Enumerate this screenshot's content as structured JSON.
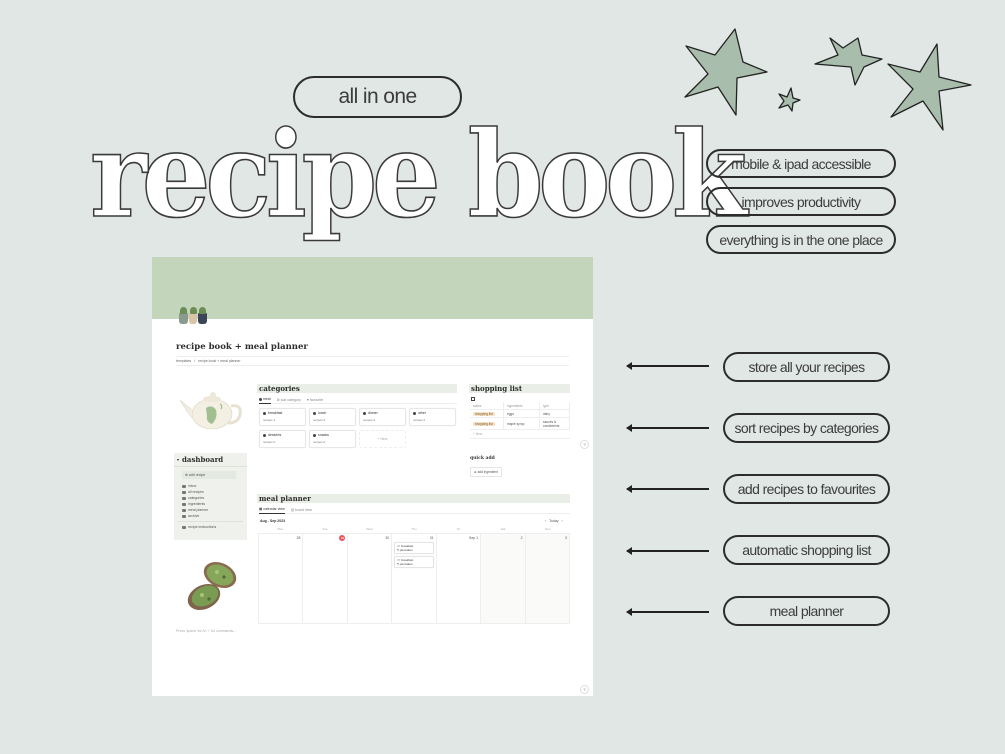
{
  "poster": {
    "tagline": "all in one",
    "title": "recipe book",
    "features": [
      "mobile & ipad accessible",
      "improves productivity",
      "everything is in the one place"
    ],
    "callouts": [
      "store all your recipes",
      "sort recipes by categories",
      "add recipes to favourites",
      "automatic shopping list",
      "meal planner"
    ],
    "accent_color": "#a8bdac",
    "background_color": "#e1e7e5"
  },
  "app": {
    "page_title": "recipe book + meal planner",
    "breadcrumb": [
      "templates",
      "recipe book + meal planner"
    ],
    "cover_color": "#c3d6bb",
    "dashboard": {
      "title": "dashboard",
      "add_button": "add recipe",
      "items": [
        "inbox",
        "all recipes",
        "categories",
        "ingredients",
        "meal planner",
        "archive"
      ],
      "extra_item": "recipe instructions"
    },
    "categories": {
      "title": "categories",
      "tabs": [
        "meal",
        "sub category",
        "favourite"
      ],
      "cards": [
        {
          "name": "breakfast",
          "count": "recipes 1"
        },
        {
          "name": "lunch",
          "count": "recipes 0"
        },
        {
          "name": "dinner",
          "count": "recipes 0"
        },
        {
          "name": "other",
          "count": "recipes 0"
        },
        {
          "name": "desserts",
          "count": "recipes 0"
        },
        {
          "name": "snacks",
          "count": "recipes 0"
        }
      ],
      "new_label": "+ New"
    },
    "shopping_list": {
      "title": "shopping list",
      "columns": [
        "status",
        "ingredients",
        "type"
      ],
      "rows": [
        {
          "status": "shopping list",
          "ingredient": "eggs",
          "type": "dairy"
        },
        {
          "status": "shopping list",
          "ingredient": "maple syrup",
          "type": "sauces & condiments"
        }
      ],
      "new_label": "+ New"
    },
    "quick_add": {
      "title": "quick add",
      "button": "add ingredient"
    },
    "meal_planner": {
      "title": "meal planner",
      "tabs": [
        "calendar view",
        "board view"
      ],
      "range": "Aug - Sep 2023",
      "today_label": "Today",
      "weekdays": [
        "Mon",
        "Tue",
        "Wed",
        "Thu",
        "Fri",
        "Sat",
        "Sun"
      ],
      "days": [
        "28",
        "29",
        "30",
        "31",
        "Sep 1",
        "2",
        "3"
      ],
      "today_index": 1,
      "events": [
        {
          "day_index": 3,
          "title": "breakfast",
          "recipe": "pancakes"
        },
        {
          "day_index": 3,
          "title": "breakfast",
          "recipe": "pancakes"
        }
      ]
    },
    "footer_hint": "Press 'space' for AI, '/' for commands...",
    "help_label": "?"
  }
}
